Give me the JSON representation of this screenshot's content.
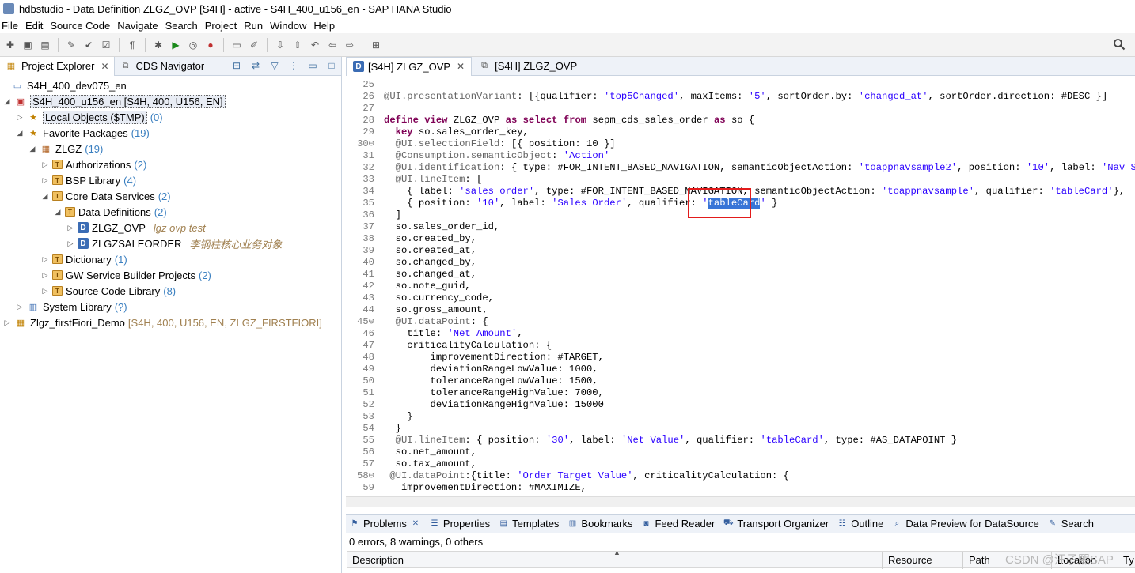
{
  "window": {
    "title": "hdbstudio - Data Definition ZLGZ_OVP [S4H] - active - S4H_400_u156_en - SAP HANA Studio"
  },
  "menu": [
    "File",
    "Edit",
    "Source Code",
    "Navigate",
    "Search",
    "Project",
    "Run",
    "Window",
    "Help"
  ],
  "left_panel": {
    "tabs": [
      {
        "label": "Project Explorer",
        "close": "✕"
      },
      {
        "label": "CDS Navigator"
      }
    ],
    "tree": [
      {
        "label": "S4H_400_dev075_en"
      },
      {
        "label": "S4H_400_u156_en [S4H, 400, U156, EN]"
      },
      {
        "label": "Local Objects ($TMP)",
        "count": "(0)"
      },
      {
        "label": "Favorite Packages",
        "count": "(19)"
      },
      {
        "label": "ZLGZ",
        "count": "(19)"
      },
      {
        "label": "Authorizations",
        "count": "(2)"
      },
      {
        "label": "BSP Library",
        "count": "(4)"
      },
      {
        "label": "Core Data Services",
        "count": "(2)"
      },
      {
        "label": "Data Definitions",
        "count": "(2)"
      },
      {
        "label": "ZLGZ_OVP",
        "desc": "lgz ovp test"
      },
      {
        "label": "ZLGZSALEORDER",
        "desc": "李钢柱核心业务对象"
      },
      {
        "label": "Dictionary",
        "count": "(1)"
      },
      {
        "label": "GW Service Builder Projects",
        "count": "(2)"
      },
      {
        "label": "Source Code Library",
        "count": "(8)"
      },
      {
        "label": "System Library",
        "count": "(?)"
      },
      {
        "label": "Zlgz_firstFiori_Demo",
        "info": "[S4H, 400, U156, EN, ZLGZ_FIRSTFIORI]"
      }
    ]
  },
  "editor": {
    "tabs": [
      {
        "label": "[S4H] ZLGZ_OVP",
        "close": "✕"
      },
      {
        "label": "[S4H] ZLGZ_OVP"
      }
    ],
    "lines": [
      {
        "n": "25",
        "text": ""
      },
      {
        "n": "26",
        "text": "@UI.presentationVariant: [{qualifier: 'top5Changed', maxItems: '5', sortOrder.by: 'changed_at', sortOrder.direction: #DESC }]"
      },
      {
        "n": "27",
        "text": ""
      },
      {
        "n": "28",
        "text": "define view ZLGZ_OVP as select from sepm_cds_sales_order as so {"
      },
      {
        "n": "29",
        "text": "  key so.sales_order_key,"
      },
      {
        "n": "30⊖",
        "text": "  @UI.selectionField: [{ position: 10 }]"
      },
      {
        "n": "31",
        "text": "  @Consumption.semanticObject: 'Action'"
      },
      {
        "n": "32",
        "text": "  @UI.identification: { type: #FOR_INTENT_BASED_NAVIGATION, semanticObjectAction: 'toappnavsample2', position: '10', label: 'Nav Sample' }"
      },
      {
        "n": "33",
        "text": "  @UI.lineItem: ["
      },
      {
        "n": "34",
        "text": "    { label: 'sales order', type: #FOR_INTENT_BASED_NAVIGATION, semanticObjectAction: 'toappnavsample', qualifier: 'tableCard'},"
      },
      {
        "n": "35",
        "text": "    { position: '10', label: 'Sales Order', qualifier: 'tableCard' }"
      },
      {
        "n": "36",
        "text": "  ]"
      },
      {
        "n": "37",
        "text": "  so.sales_order_id,"
      },
      {
        "n": "38",
        "text": "  so.created_by,"
      },
      {
        "n": "39",
        "text": "  so.created_at,"
      },
      {
        "n": "40",
        "text": "  so.changed_by,"
      },
      {
        "n": "41",
        "text": "  so.changed_at,"
      },
      {
        "n": "42",
        "text": "  so.note_guid,"
      },
      {
        "n": "43",
        "text": "  so.currency_code,"
      },
      {
        "n": "44",
        "text": "  so.gross_amount,"
      },
      {
        "n": "45⊖",
        "text": "  @UI.dataPoint: {"
      },
      {
        "n": "46",
        "text": "    title: 'Net Amount',"
      },
      {
        "n": "47",
        "text": "    criticalityCalculation: {"
      },
      {
        "n": "48",
        "text": "        improvementDirection: #TARGET,"
      },
      {
        "n": "49",
        "text": "        deviationRangeLowValue: 1000,"
      },
      {
        "n": "50",
        "text": "        toleranceRangeLowValue: 1500,"
      },
      {
        "n": "51",
        "text": "        toleranceRangeHighValue: 7000,"
      },
      {
        "n": "52",
        "text": "        deviationRangeHighValue: 15000"
      },
      {
        "n": "53",
        "text": "    }"
      },
      {
        "n": "54",
        "text": "  }"
      },
      {
        "n": "55",
        "text": "  @UI.lineItem: { position: '30', label: 'Net Value', qualifier: 'tableCard', type: #AS_DATAPOINT }"
      },
      {
        "n": "56",
        "text": "  so.net_amount,"
      },
      {
        "n": "57",
        "text": "  so.tax_amount,"
      },
      {
        "n": "58⊖",
        "text": " @UI.dataPoint:{title: 'Order Target Value', criticalityCalculation: {"
      },
      {
        "n": "59",
        "text": "   improvementDirection: #MAXIMIZE,"
      }
    ]
  },
  "bottom_panel": {
    "tabs": [
      "Problems",
      "Properties",
      "Templates",
      "Bookmarks",
      "Feed Reader",
      "Transport Organizer",
      "Outline",
      "Data Preview for DataSource",
      "Search"
    ],
    "status": "0 errors, 8 warnings, 0 others",
    "columns": [
      "Description",
      "Resource",
      "Path",
      "Location",
      "Ty"
    ]
  },
  "watermark": "CSDN @汪子熙SAP"
}
